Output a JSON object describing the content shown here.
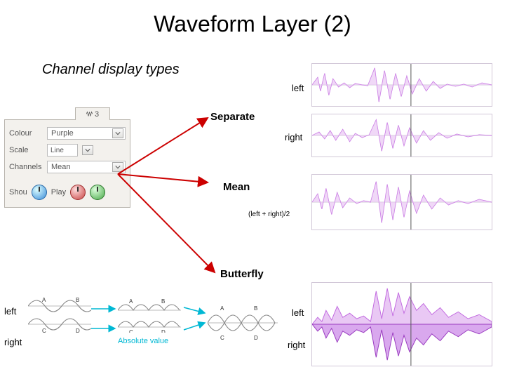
{
  "title": "Waveform Layer (2)",
  "subtitle": "Channel display types",
  "panel": {
    "tab_label": "3",
    "rows": {
      "colour": {
        "label": "Colour",
        "value": "Purple"
      },
      "scale": {
        "label": "Scale",
        "value": "Line"
      },
      "channels": {
        "label": "Channels",
        "value": "Mean"
      }
    },
    "show_prefix": "Shou",
    "play_label": "Play"
  },
  "sections": {
    "separate": {
      "label": "Separate",
      "ch_left": "left",
      "ch_right": "right"
    },
    "mean": {
      "label": "Mean",
      "formula": "(left + right)/2"
    },
    "butterfly": {
      "label": "Butterfly",
      "ch_left": "left",
      "ch_right": "right"
    }
  },
  "diagram": {
    "left": "left",
    "right": "right",
    "abs": "Absolute value",
    "letters": {
      "a": "A",
      "b": "B",
      "c": "C",
      "d": "D"
    }
  },
  "colors": {
    "wave": "#c26be0",
    "wave_dark": "#9a3cc0"
  }
}
